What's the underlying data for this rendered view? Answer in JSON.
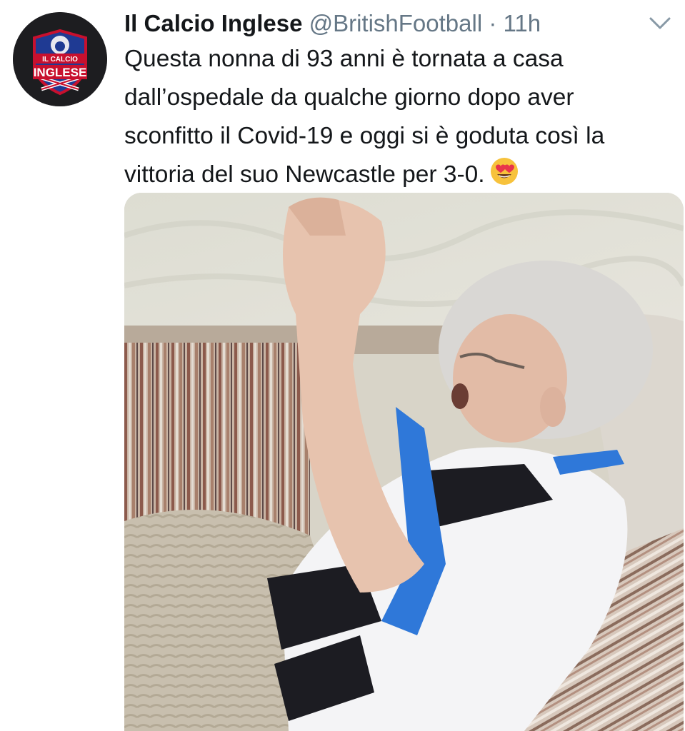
{
  "tweet": {
    "author": {
      "display_name": "Il Calcio Inglese",
      "handle": "@BritishFootball",
      "separator": "·",
      "time": "11h",
      "avatar_logo_text": "IL CALCIO INGLESE"
    },
    "text_lines": [
      "Questa nonna di 93 anni è tornata a casa",
      "dall’ospedale da qualche giorno dopo aver",
      "sconfitto il Covid-19 e oggi si è goduta così la",
      "vittoria del suo Newcastle per 3-0."
    ],
    "emoji": "heart-eyes-emoji",
    "menu_icon": "chevron-down-icon",
    "media": {
      "type": "video-frame",
      "description_icon": "video-thumbnail"
    }
  },
  "colors": {
    "text": "#14171a",
    "secondary": "#657786",
    "background": "#ffffff",
    "avatar_bg": "#1d1d20",
    "logo_red": "#c8102e",
    "logo_blue": "#1f3a93"
  }
}
